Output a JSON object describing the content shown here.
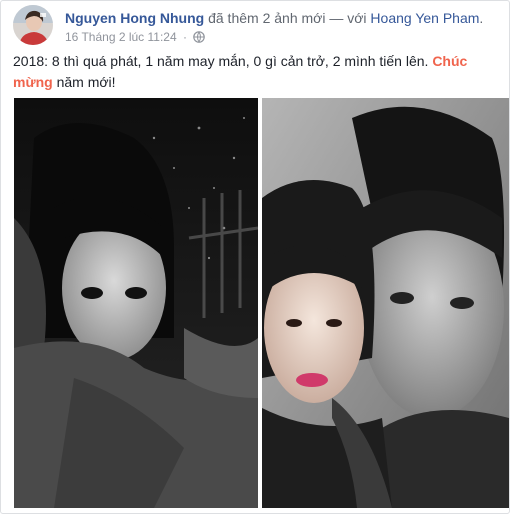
{
  "post": {
    "author": "Nguyen Hong Nhung",
    "action": "đã thêm 2 ảnh mới",
    "with_prefix": "— với",
    "tagged": "Hoang Yen Pham",
    "period": ".",
    "timestamp": "16 Tháng 2 lúc 11:24",
    "dot": "·",
    "privacy_icon": "globe-icon",
    "text_main": "2018: 8 thì quá phát, 1 năm may mắn, 0 gì cản trở, 2 mình tiến lên.",
    "text_highlight": "Chúc mừng",
    "text_end": "năm mới!"
  },
  "colors": {
    "link": "#365899",
    "meta": "#90949c",
    "highlight": "#f0644d"
  },
  "photos": [
    {
      "name": "photo-left",
      "icon": "photo-image"
    },
    {
      "name": "photo-right",
      "icon": "photo-image"
    }
  ]
}
